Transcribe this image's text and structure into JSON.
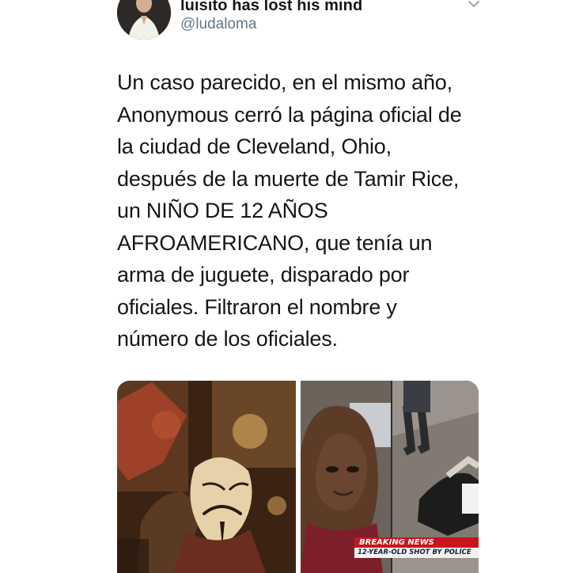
{
  "tweet": {
    "display_name": "luisito has lost his mind",
    "handle": "@ludaloma",
    "text": "Un caso parecido, en el mismo año,\nAnonymous cerró la página oficial de\nla ciudad de Cleveland, Ohio,\ndespués de la muerte de Tamir Rice,\nun NIÑO DE 12 AÑOS\nAFROAMERICANO, que tenía un\narma de juguete, disparado por\noficiales. Filtraron el nombre y\nnúmero de los oficiales.",
    "media": {
      "news_banner_top": "BREAKING NEWS",
      "news_banner_bottom": "12-YEAR-OLD SHOT BY POLICE"
    },
    "icons": {
      "menu": "chevron-down-icon"
    }
  }
}
